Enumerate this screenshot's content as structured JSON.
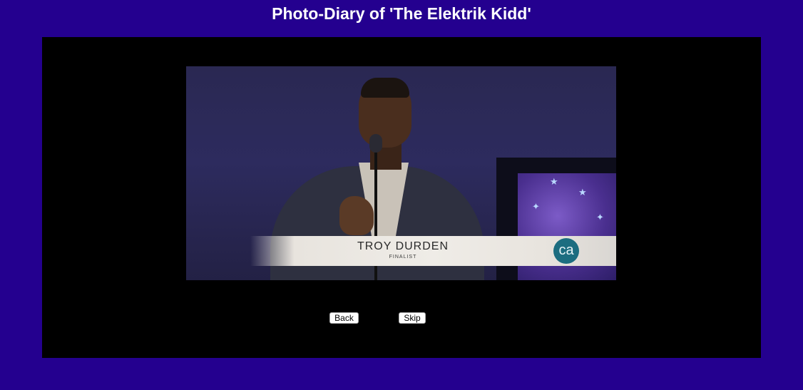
{
  "header": {
    "title": "Photo-Diary of 'The Elektrik Kidd'"
  },
  "photo": {
    "caption_name": "TROY DURDEN",
    "caption_subtitle": "FINALIST",
    "logo_text": "ca"
  },
  "controls": {
    "back_label": "Back",
    "skip_label": "Skip"
  },
  "colors": {
    "page_background": "#24008f",
    "stage_background": "#000000",
    "title_color": "#ffffff"
  }
}
